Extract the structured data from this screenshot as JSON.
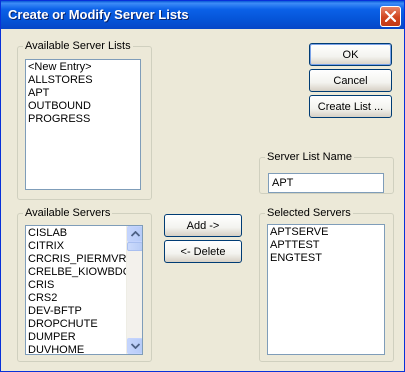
{
  "window": {
    "title": "Create or Modify Server Lists"
  },
  "available_server_lists": {
    "label": "Available Server Lists",
    "items": [
      "<New Entry>",
      "ALLSTORES",
      "APT",
      "OUTBOUND",
      "PROGRESS"
    ]
  },
  "buttons": {
    "ok": "OK",
    "cancel": "Cancel",
    "create_list": "Create List ...",
    "add": "Add ->",
    "delete": "<- Delete"
  },
  "server_list_name": {
    "label": "Server List Name",
    "value": "APT"
  },
  "available_servers": {
    "label": "Available Servers",
    "items": [
      "CISLAB",
      "CITRIX",
      "CRCRIS_PIERMVR",
      "CRELBE_KIOWBDC",
      "CRIS",
      "CRS2",
      "DEV-BFTP",
      "DROPCHUTE",
      "DUMPER",
      "DUVHOME"
    ]
  },
  "selected_servers": {
    "label": "Selected Servers",
    "items": [
      "APTSERVE",
      "APTTEST",
      "ENGTEST"
    ]
  },
  "icons": {
    "close": "close-icon",
    "scroll_up": "arrow-up-icon",
    "scroll_down": "arrow-down-icon"
  },
  "colors": {
    "titlebar": "#0553d6",
    "dialog_background": "#ece9d8",
    "close_button": "#d1451f",
    "list_border": "#7f9db9"
  }
}
